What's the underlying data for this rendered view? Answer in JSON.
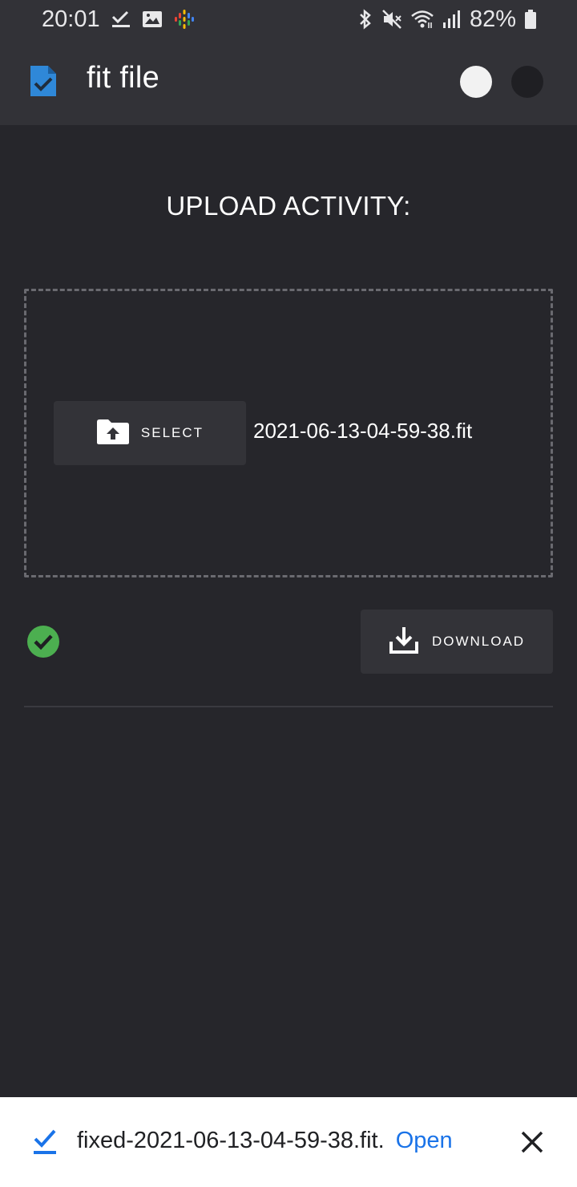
{
  "status_bar": {
    "time": "20:01",
    "battery": "82%",
    "left_icons": [
      "check-notification-icon",
      "gallery-icon",
      "podcast-icon"
    ],
    "right_icons": [
      "bluetooth-icon",
      "mute-icon",
      "wifi-icon",
      "signal-icon",
      "battery-icon"
    ]
  },
  "app_bar": {
    "title": "fit file",
    "logo_icon": "file-check-icon",
    "theme_options": [
      "light-theme-toggle",
      "dark-theme-toggle"
    ]
  },
  "main": {
    "heading": "UPLOAD ACTIVITY:",
    "select_label": "SELECT",
    "select_icon": "folder-upload-icon",
    "file_name": "2021-06-13-04-59-38.fit",
    "status_icon": "success-check-icon",
    "download_label": "DOWNLOAD",
    "download_icon": "download-icon"
  },
  "download_bar": {
    "message": "fixed-2021-06-13-04-59-38.fit.",
    "open_label": "Open",
    "icons": [
      "download-complete-icon",
      "close-icon"
    ]
  },
  "colors": {
    "background": "#26262b",
    "app_bar": "#323237",
    "button": "#333338",
    "success": "#4caf50",
    "link": "#1a73e8",
    "logo": "#2f88d8"
  }
}
